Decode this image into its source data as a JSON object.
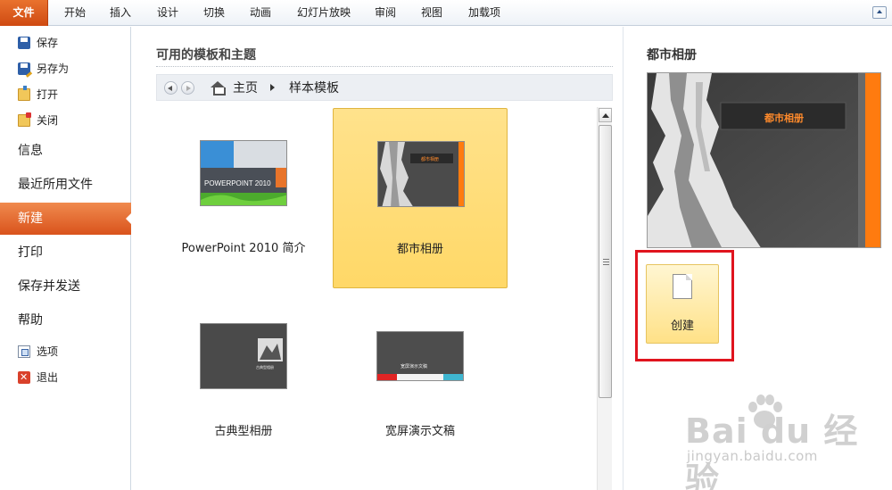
{
  "ribbon": {
    "tabs": [
      "文件",
      "开始",
      "插入",
      "设计",
      "切换",
      "动画",
      "幻灯片放映",
      "审阅",
      "视图",
      "加载项"
    ]
  },
  "nav": {
    "save": "保存",
    "save_as": "另存为",
    "open": "打开",
    "close": "关闭",
    "info": "信息",
    "recent": "最近所用文件",
    "new": "新建",
    "print": "打印",
    "save_send": "保存并发送",
    "help": "帮助",
    "options": "选项",
    "exit": "退出"
  },
  "middle": {
    "title": "可用的模板和主题",
    "breadcrumb": {
      "home": "主页",
      "current": "样本模板"
    },
    "templates": [
      {
        "label": "PowerPoint 2010 简介",
        "thumb_text": "POWERPOINT 2010",
        "selected": false
      },
      {
        "label": "都市相册",
        "thumb_text": "都市相册",
        "selected": true
      },
      {
        "label": "古典型相册",
        "thumb_text": "古典型相册",
        "selected": false
      },
      {
        "label": "宽屏演示文稿",
        "thumb_text": "宽屏演示文稿",
        "selected": false
      }
    ]
  },
  "right": {
    "title": "都市相册",
    "preview_text": "都市相册",
    "create_label": "创建"
  },
  "colors": {
    "file_tab": "#d9531c",
    "selected_tile": "#ffd867",
    "highlight": "#e0141e",
    "accent_orange": "#ff7b0f"
  },
  "watermark": {
    "logo": "Bai du 经验",
    "url": "jingyan.baidu.com"
  }
}
